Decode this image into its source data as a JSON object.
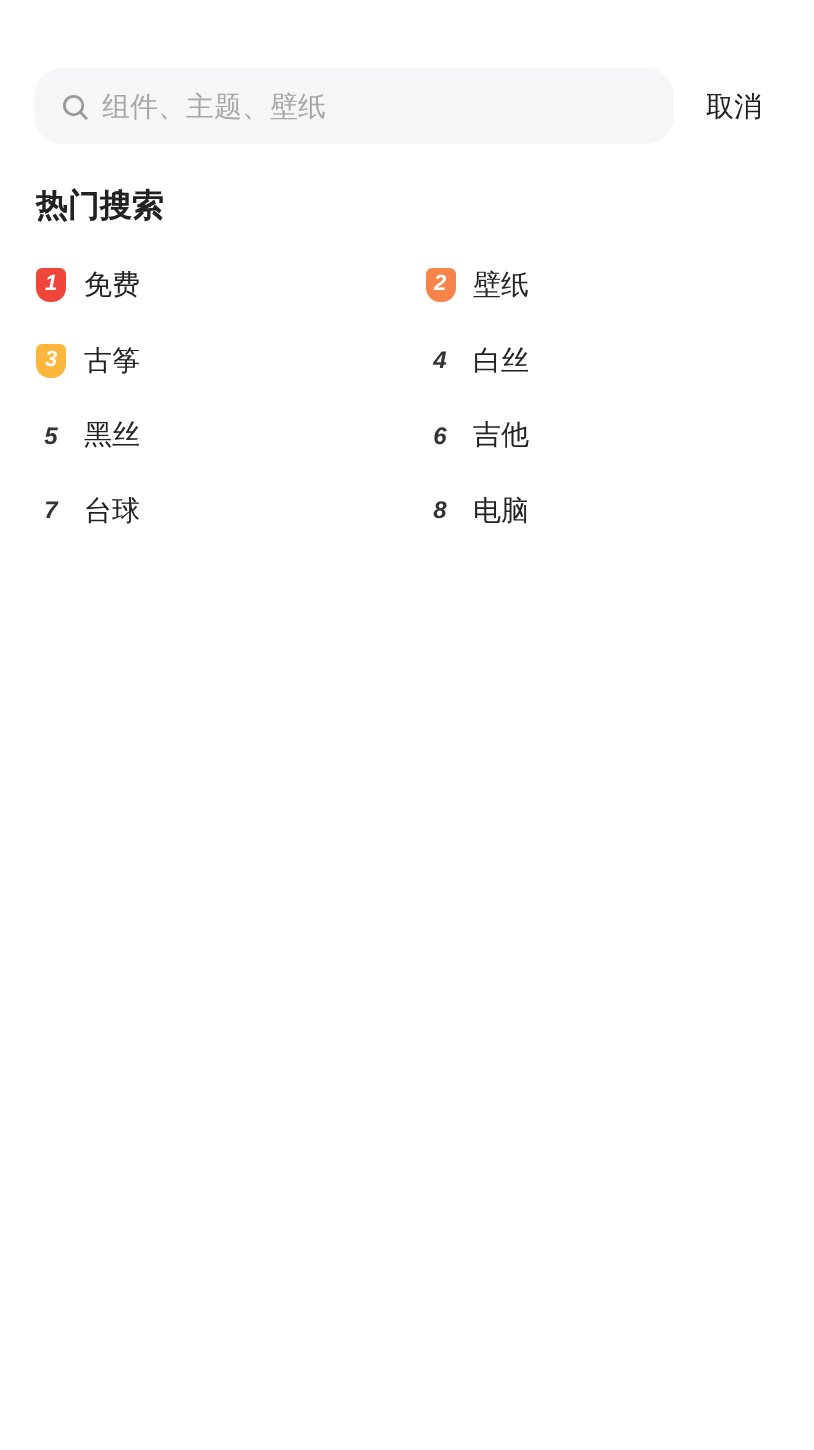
{
  "search": {
    "placeholder": "组件、主题、壁纸"
  },
  "cancel": "取消",
  "hot_search": {
    "title": "热门搜索",
    "items": [
      {
        "rank": "1",
        "label": "免费",
        "kind": "badge",
        "color": "#f0453a"
      },
      {
        "rank": "2",
        "label": "壁纸",
        "kind": "badge",
        "color": "#f7844a"
      },
      {
        "rank": "3",
        "label": "古筝",
        "kind": "badge",
        "color": "#fbb63b"
      },
      {
        "rank": "4",
        "label": "白丝",
        "kind": "plain"
      },
      {
        "rank": "5",
        "label": "黑丝",
        "kind": "plain"
      },
      {
        "rank": "6",
        "label": "吉他",
        "kind": "plain"
      },
      {
        "rank": "7",
        "label": "台球",
        "kind": "plain"
      },
      {
        "rank": "8",
        "label": "电脑",
        "kind": "plain"
      }
    ]
  }
}
